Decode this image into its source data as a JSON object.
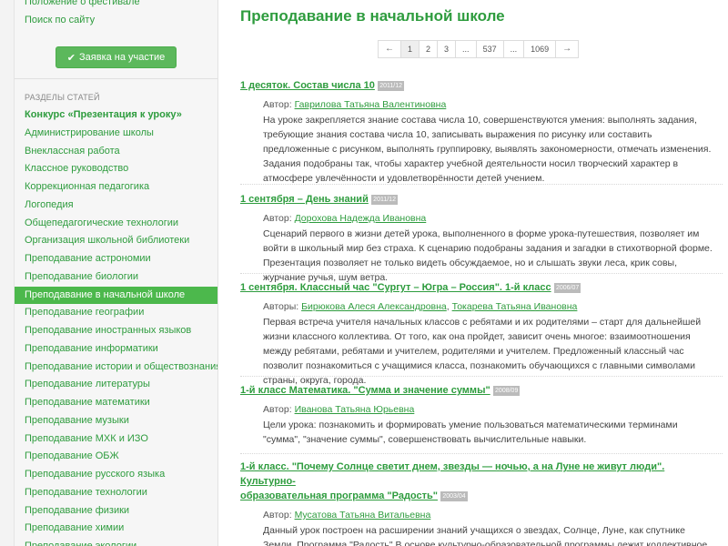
{
  "sidebar": {
    "top_links": [
      "Положение о фестивале",
      "Поиск по сайту"
    ],
    "cta_label": "Заявка на участие",
    "section_header": "РАЗДЕЛЫ СТАТЕЙ",
    "items": [
      "Конкурс «Презентация к уроку»",
      "Администрирование школы",
      "Внеклассная работа",
      "Классное руководство",
      "Коррекционная педагогика",
      "Логопедия",
      "Общепедагогические технологии",
      "Организация школьной библиотеки",
      "Преподавание астрономии",
      "Преподавание биологии",
      "Преподавание в начальной школе",
      "Преподавание географии",
      "Преподавание иностранных языков",
      "Преподавание информатики",
      "Преподавание истории и обществознания",
      "Преподавание литературы",
      "Преподавание математики",
      "Преподавание музыки",
      "Преподавание МХК и ИЗО",
      "Преподавание ОБЖ",
      "Преподавание русского языка",
      "Преподавание технологии",
      "Преподавание физики",
      "Преподавание химии",
      "Преподавание экологии"
    ],
    "active_item": "Преподавание в начальной школе"
  },
  "main": {
    "title": "Преподавание в начальной школе",
    "pagination": {
      "prev": "←",
      "pages": [
        "1",
        "2",
        "3",
        "...",
        "537",
        "...",
        "1069"
      ],
      "next": "→",
      "current": "1"
    },
    "articles": [
      {
        "title": "1 десяток. Состав числа 10",
        "badge": "2011/12",
        "author_label": "Автор:",
        "authors": [
          "Гаврилова Татьяна Валентиновна"
        ],
        "description": "На уроке закрепляется знание состава числа 10, совершенствуются умения: выполнять задания, требующие знания состава числа 10, записывать выражения по рисунку или составить предложенные с рисунком, выполнять группировку, выявлять закономерности, отмечать изменения. Задания подобраны так, чтобы характер учебной деятельности носил творческий характер в атмосфере увлечённости и удовлетворённости детей учением."
      },
      {
        "title": "1 сентября – День знаний",
        "badge": "2011/12",
        "author_label": "Автор:",
        "authors": [
          "Дорохова Надежда Ивановна"
        ],
        "description": "Сценарий первого в жизни детей урока, выполненного в форме урока-путешествия, позволяет им войти в школьный мир без страха. К сценарию подобраны задания и загадки в стихотворной форме. Презентация позволяет не только видеть обсуждаемое, но и слышать звуки леса, крик совы, журчание ручья, шум ветра."
      },
      {
        "title": "1 сентября. Классный час \"Сургут – Югра – Россия\". 1-й класс",
        "badge": "2006/07",
        "author_label": "Авторы:",
        "authors": [
          "Бирюкова Алеся Александровна",
          "Токарева Татьяна Ивановна"
        ],
        "author_sep": ", ",
        "description": "Первая встреча учителя начальных классов с ребятами и их родителями – старт для дальнейшей жизни классного коллектива. От того, как она пройдет, зависит очень многое: взаимоотношения между ребятами, ребятами и учителем, родителями и учителем. Предложенный классный час позволит познакомиться с учащимися класса, познакомить обучающихся с главными символами страны, округа, города."
      },
      {
        "title": "1-й класс Математика. \"Сумма и значение суммы\"",
        "badge": "2008/09",
        "author_label": "Автор:",
        "authors": [
          "Иванова Татьяна Юрьевна"
        ],
        "description": "Цели урока: познакомить и формировать умение пользоваться математическими терминами \"сумма\", \"значение суммы\", совершенствовать вычислительные навыки."
      },
      {
        "title_line1": "1-й класс. \"Почему Солнце светит днем, звезды — ночью, а на Луне не живут люди\". Культурно-",
        "title_line2": "образовательная программа \"Радость\"",
        "badge": "2003/04",
        "author_label": "Автор:",
        "authors": [
          "Мусатова Татьяна Витальевна"
        ],
        "description": "Данный урок построен на расширении знаний учащихся о звездах, Солнце, Луне, как спутнике Земли. Программа \"Радость\" В основе культурно-образовательной программы лежит коллективное планирование и целенаправленный активный досуг."
      }
    ]
  },
  "colors": {
    "accent": "#2e9c3e",
    "active_bg": "#4cb84c",
    "button_bg": "#5cb85c",
    "badge_bg": "#bbbbbb"
  }
}
